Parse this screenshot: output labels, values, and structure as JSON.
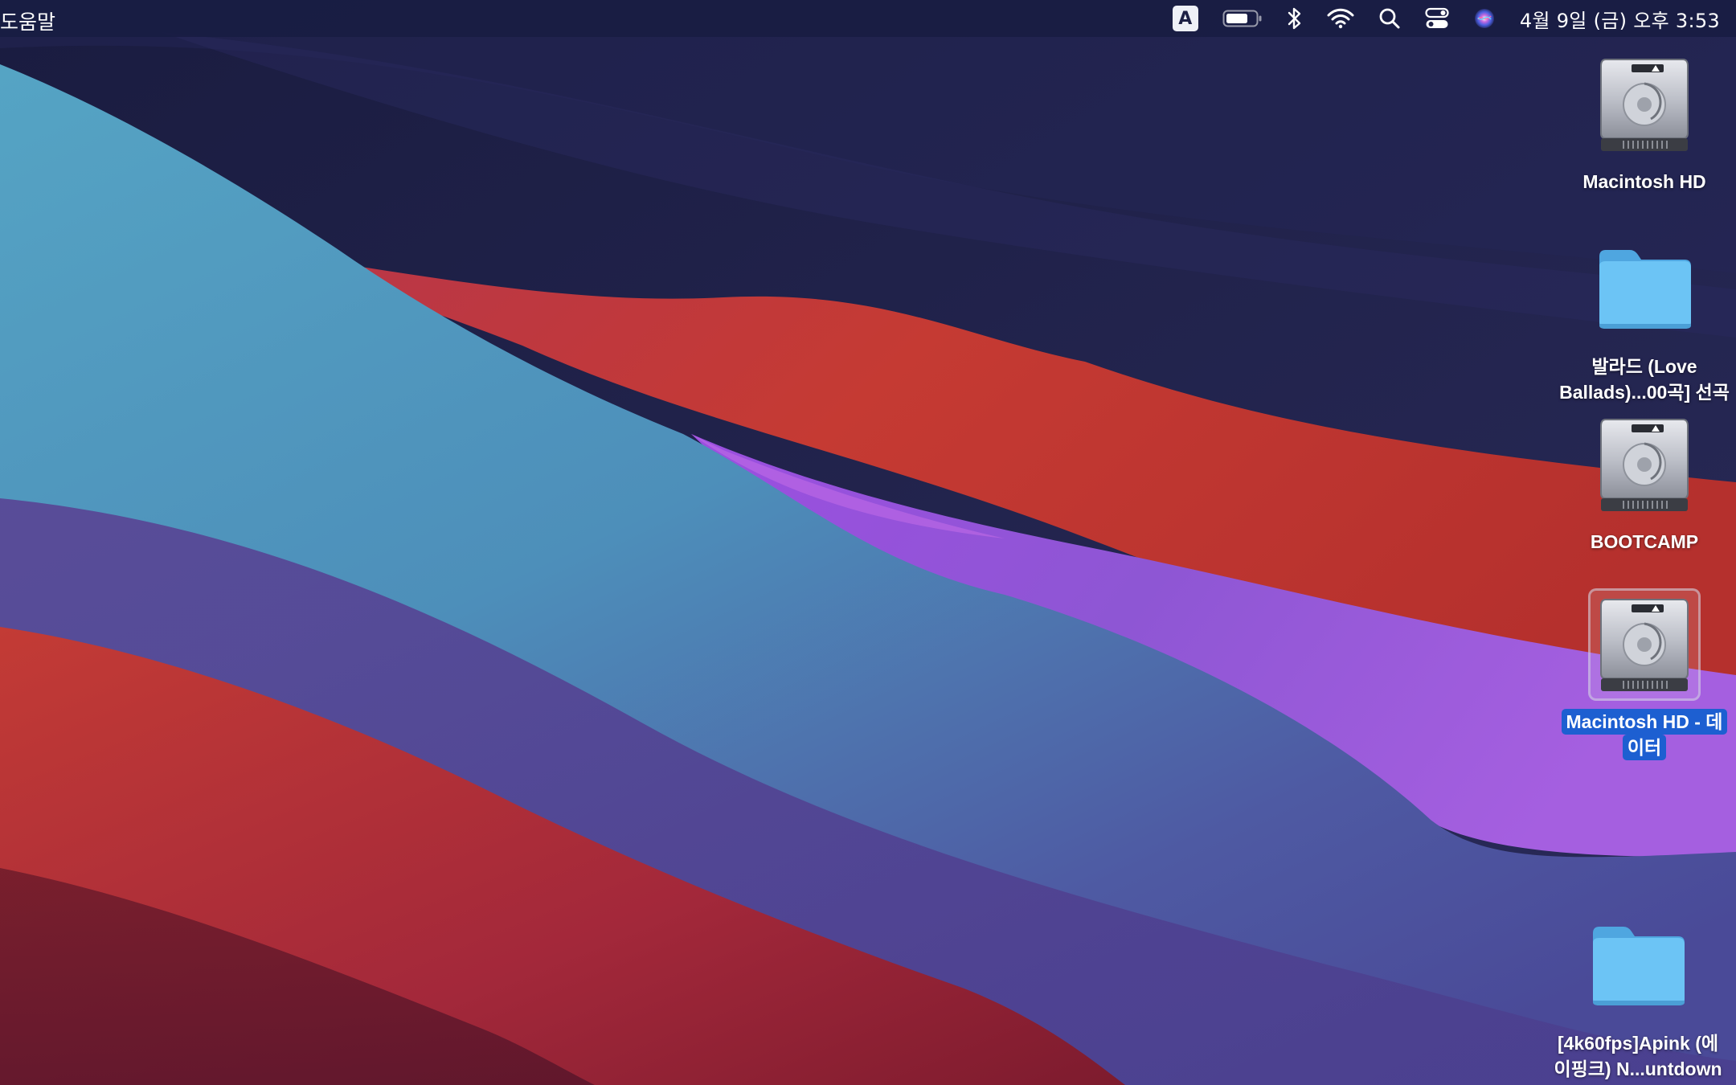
{
  "menubar": {
    "app_menu_item": "도움말",
    "input_source": "A",
    "clock": "4월 9일 (금) 오후  3:53",
    "icons": [
      "battery-icon",
      "bluetooth-icon",
      "wifi-icon",
      "spotlight-search-icon",
      "control-center-icon",
      "siri-icon"
    ]
  },
  "desktop": {
    "items": [
      {
        "label_lines": [
          "Macintosh HD"
        ],
        "icon": "hard-drive-icon",
        "selected": false
      },
      {
        "label_lines": [
          "발라드 (Love",
          "Ballads)...00곡] 선곡"
        ],
        "icon": "folder-icon",
        "selected": false
      },
      {
        "label_lines": [
          "BOOTCAMP"
        ],
        "icon": "hard-drive-icon",
        "selected": false
      },
      {
        "label_lines": [
          "Macintosh HD - 데",
          "이터"
        ],
        "icon": "hard-drive-icon",
        "selected": true
      },
      {
        "label_lines": [
          "[4k60fps]Apink (에",
          "이핑크) N...untdown"
        ],
        "icon": "folder-icon",
        "selected": false
      }
    ]
  },
  "colors": {
    "menubar": "#181c42",
    "wallpaper_navy": "#1b1d45",
    "wallpaper_red": "#c53a33",
    "wallpaper_teal": "#4f9bbd",
    "wallpaper_violet": "#9a55d8",
    "folder_blue": "#6cc4f5",
    "selection_blue": "#1d5fd1"
  }
}
